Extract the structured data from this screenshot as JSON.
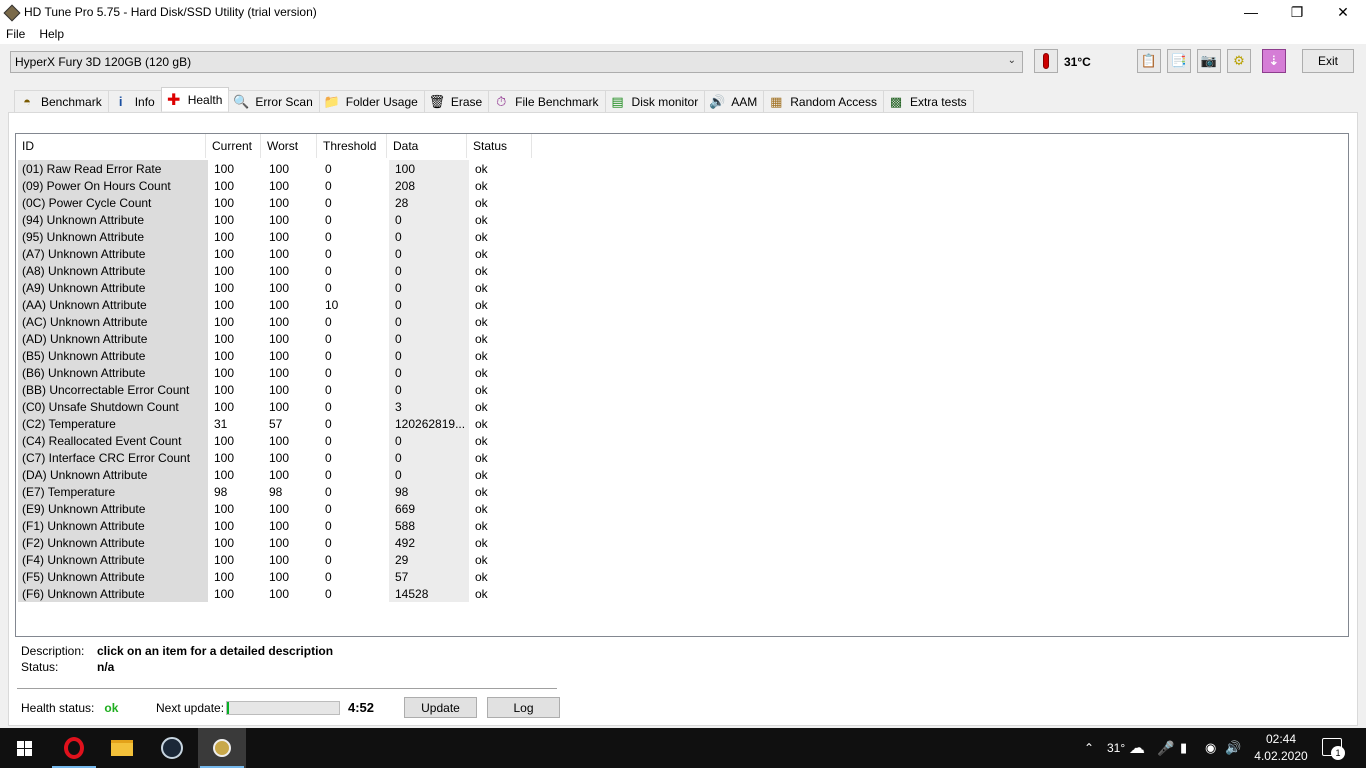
{
  "window": {
    "title": "HD Tune Pro 5.75 - Hard Disk/SSD Utility (trial version)"
  },
  "menu": {
    "file": "File",
    "help": "Help"
  },
  "toolbar": {
    "drive": "HyperX Fury 3D 120GB (120 gB)",
    "temperature": "31°C",
    "exit": "Exit"
  },
  "tabs": [
    {
      "label": "Benchmark",
      "icon": "benchmark-icon"
    },
    {
      "label": "Info",
      "icon": "info-icon"
    },
    {
      "label": "Health",
      "icon": "health-cross-icon",
      "active": true
    },
    {
      "label": "Error Scan",
      "icon": "magnifier-icon"
    },
    {
      "label": "Folder Usage",
      "icon": "folder-icon"
    },
    {
      "label": "Erase",
      "icon": "trash-icon"
    },
    {
      "label": "File Benchmark",
      "icon": "file-benchmark-icon"
    },
    {
      "label": "Disk monitor",
      "icon": "disk-monitor-icon"
    },
    {
      "label": "AAM",
      "icon": "speaker-icon"
    },
    {
      "label": "Random Access",
      "icon": "random-access-icon"
    },
    {
      "label": "Extra tests",
      "icon": "extra-tests-icon"
    }
  ],
  "smart": {
    "columns": [
      "ID",
      "Current",
      "Worst",
      "Threshold",
      "Data",
      "Status"
    ],
    "rows": [
      [
        "(01) Raw Read Error Rate",
        "100",
        "100",
        "0",
        "100",
        "ok"
      ],
      [
        "(09) Power On Hours Count",
        "100",
        "100",
        "0",
        "208",
        "ok"
      ],
      [
        "(0C) Power Cycle Count",
        "100",
        "100",
        "0",
        "28",
        "ok"
      ],
      [
        "(94) Unknown Attribute",
        "100",
        "100",
        "0",
        "0",
        "ok"
      ],
      [
        "(95) Unknown Attribute",
        "100",
        "100",
        "0",
        "0",
        "ok"
      ],
      [
        "(A7) Unknown Attribute",
        "100",
        "100",
        "0",
        "0",
        "ok"
      ],
      [
        "(A8) Unknown Attribute",
        "100",
        "100",
        "0",
        "0",
        "ok"
      ],
      [
        "(A9) Unknown Attribute",
        "100",
        "100",
        "0",
        "0",
        "ok"
      ],
      [
        "(AA) Unknown Attribute",
        "100",
        "100",
        "10",
        "0",
        "ok"
      ],
      [
        "(AC) Unknown Attribute",
        "100",
        "100",
        "0",
        "0",
        "ok"
      ],
      [
        "(AD) Unknown Attribute",
        "100",
        "100",
        "0",
        "0",
        "ok"
      ],
      [
        "(B5) Unknown Attribute",
        "100",
        "100",
        "0",
        "0",
        "ok"
      ],
      [
        "(B6) Unknown Attribute",
        "100",
        "100",
        "0",
        "0",
        "ok"
      ],
      [
        "(BB) Uncorrectable Error Count",
        "100",
        "100",
        "0",
        "0",
        "ok"
      ],
      [
        "(C0) Unsafe Shutdown Count",
        "100",
        "100",
        "0",
        "3",
        "ok"
      ],
      [
        "(C2) Temperature",
        "31",
        "57",
        "0",
        "120262819...",
        "ok"
      ],
      [
        "(C4) Reallocated Event Count",
        "100",
        "100",
        "0",
        "0",
        "ok"
      ],
      [
        "(C7) Interface CRC Error Count",
        "100",
        "100",
        "0",
        "0",
        "ok"
      ],
      [
        "(DA) Unknown Attribute",
        "100",
        "100",
        "0",
        "0",
        "ok"
      ],
      [
        "(E7) Temperature",
        "98",
        "98",
        "0",
        "98",
        "ok"
      ],
      [
        "(E9) Unknown Attribute",
        "100",
        "100",
        "0",
        "669",
        "ok"
      ],
      [
        "(F1) Unknown Attribute",
        "100",
        "100",
        "0",
        "588",
        "ok"
      ],
      [
        "(F2) Unknown Attribute",
        "100",
        "100",
        "0",
        "492",
        "ok"
      ],
      [
        "(F4) Unknown Attribute",
        "100",
        "100",
        "0",
        "29",
        "ok"
      ],
      [
        "(F5) Unknown Attribute",
        "100",
        "100",
        "0",
        "57",
        "ok"
      ],
      [
        "(F6) Unknown Attribute",
        "100",
        "100",
        "0",
        "14528",
        "ok"
      ]
    ]
  },
  "details": {
    "description_label": "Description:",
    "description_value": "click on an item for a detailed description",
    "status_label": "Status:",
    "status_value": "n/a"
  },
  "footer": {
    "health_label": "Health status:",
    "health_value": "ok",
    "next_update_label": "Next update:",
    "progress": 0.02,
    "timer": "4:52",
    "update_button": "Update",
    "log_button": "Log",
    "health_color": "#1fae1f"
  },
  "taskbar": {
    "temp": "31°",
    "time": "02:44",
    "date": "4.02.2020",
    "notifications": "1"
  }
}
